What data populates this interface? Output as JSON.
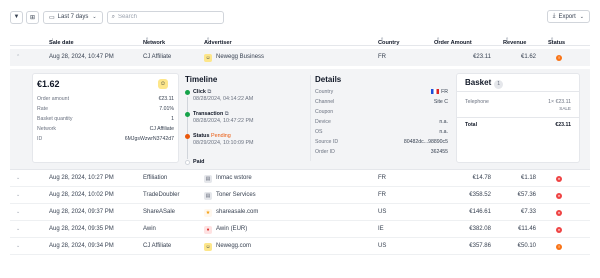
{
  "toolbar": {
    "filter_icon": "filter-icon",
    "columns_icon": "columns-icon",
    "date_range": "Last 7 days",
    "search_placeholder": "Search",
    "export_label": "Export"
  },
  "columns": {
    "sale_date": "Sale date",
    "network": "Network",
    "advertiser": "Advertiser",
    "country": "Country",
    "order_amount": "Order Amount",
    "revenue": "Revenue",
    "status": "Status"
  },
  "expanded_row": {
    "sale_date": "Aug 28, 2024, 10:47 PM",
    "network": "CJ Affiliate",
    "advertiser": "Newegg Business",
    "country": "FR",
    "order_amount": "€23.11",
    "revenue": "€1.62",
    "status": "pending"
  },
  "detail": {
    "summary": {
      "amount": "€1.62",
      "rows": [
        {
          "label": "Order amount",
          "value": "€23.11"
        },
        {
          "label": "Rate",
          "value": "7.01%"
        },
        {
          "label": "Basket quantity",
          "value": "1"
        },
        {
          "label": "Network",
          "value": "CJ Affiliate"
        },
        {
          "label": "ID",
          "value": "6MJgsWzwrN3742d7"
        }
      ]
    },
    "timeline": {
      "title": "Timeline",
      "click_label": "Click",
      "click_time": "08/28/2024, 04:14:22 AM",
      "transaction_label": "Transaction",
      "transaction_time": "08/28/2024, 10:47:22 PM",
      "status_label": "Status",
      "status_value": "Pending",
      "status_time": "08/29/2024, 10:10:09 PM",
      "paid_label": "Paid"
    },
    "details": {
      "title": "Details",
      "rows": [
        {
          "label": "Country",
          "value": "FR"
        },
        {
          "label": "Channel",
          "value": "Site C"
        },
        {
          "label": "Coupon",
          "value": ""
        },
        {
          "label": "Device",
          "value": "n.a."
        },
        {
          "label": "OS",
          "value": "n.a."
        },
        {
          "label": "Source ID",
          "value": "80482dc...98890c5"
        },
        {
          "label": "Order ID",
          "value": "362455"
        }
      ]
    },
    "basket": {
      "title": "Basket",
      "count": "1",
      "item_name": "Telephone",
      "item_qty_price": "1× €23.11",
      "item_tag": "SALE",
      "total_label": "Total",
      "total_value": "€23.11"
    }
  },
  "rows": [
    {
      "sale_date": "Aug 28, 2024, 10:27 PM",
      "network": "Effiliation",
      "advertiser": "Inmac wstore",
      "country": "FR",
      "order_amount": "€14.78",
      "revenue": "€1.18",
      "status": "rejected"
    },
    {
      "sale_date": "Aug 28, 2024, 10:02 PM",
      "network": "TradeDoubler",
      "advertiser": "Toner Services",
      "country": "FR",
      "order_amount": "€358.52",
      "revenue": "€57.36",
      "status": "rejected"
    },
    {
      "sale_date": "Aug 28, 2024, 09:37 PM",
      "network": "ShareASale",
      "advertiser": "shareasale.com",
      "country": "US",
      "order_amount": "€146.61",
      "revenue": "€7.33",
      "status": "rejected"
    },
    {
      "sale_date": "Aug 28, 2024, 09:35 PM",
      "network": "Awin",
      "advertiser": "Awin (EUR)",
      "country": "IE",
      "order_amount": "€382.08",
      "revenue": "€11.46",
      "status": "rejected"
    },
    {
      "sale_date": "Aug 28, 2024, 09:34 PM",
      "network": "CJ Affiliate",
      "advertiser": "Newegg.com",
      "country": "US",
      "order_amount": "€357.86",
      "revenue": "€50.10",
      "status": "pending"
    }
  ],
  "colors": {
    "pending": "#f97316",
    "rejected": "#ef4444",
    "timeline_green": "#16a34a",
    "timeline_orange": "#ea580c"
  }
}
